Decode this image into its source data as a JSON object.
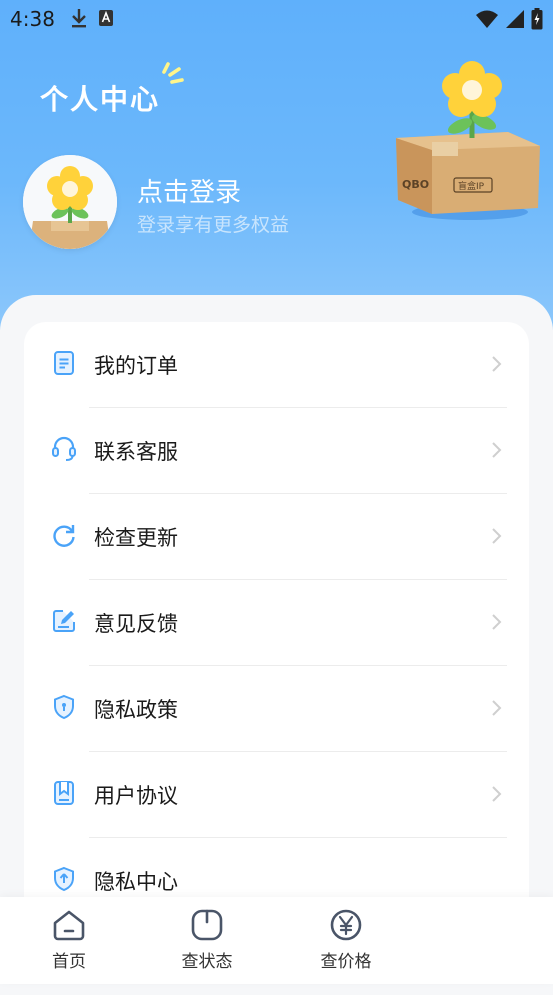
{
  "status_bar": {
    "time": "4:38"
  },
  "header": {
    "title": "个人中心",
    "login_title": "点击登录",
    "login_subtitle": "登录享有更多权益",
    "hero_box_text_left": "QBO",
    "hero_box_text_right": "盲盒IP"
  },
  "menu": [
    {
      "label": "我的订单",
      "icon": "order-icon"
    },
    {
      "label": "联系客服",
      "icon": "headset-icon"
    },
    {
      "label": "检查更新",
      "icon": "refresh-icon"
    },
    {
      "label": "意见反馈",
      "icon": "feedback-edit-icon"
    },
    {
      "label": "隐私政策",
      "icon": "shield-icon"
    },
    {
      "label": "用户协议",
      "icon": "bookmark-icon"
    },
    {
      "label": "隐私中心",
      "icon": "shield-icon"
    }
  ],
  "bottom_nav": [
    {
      "label": "首页",
      "icon": "home-icon"
    },
    {
      "label": "查状态",
      "icon": "power-icon"
    },
    {
      "label": "查价格",
      "icon": "yen-icon"
    }
  ],
  "colors": {
    "accent": "#4aa3f8",
    "header_top": "#5fb0fb"
  }
}
